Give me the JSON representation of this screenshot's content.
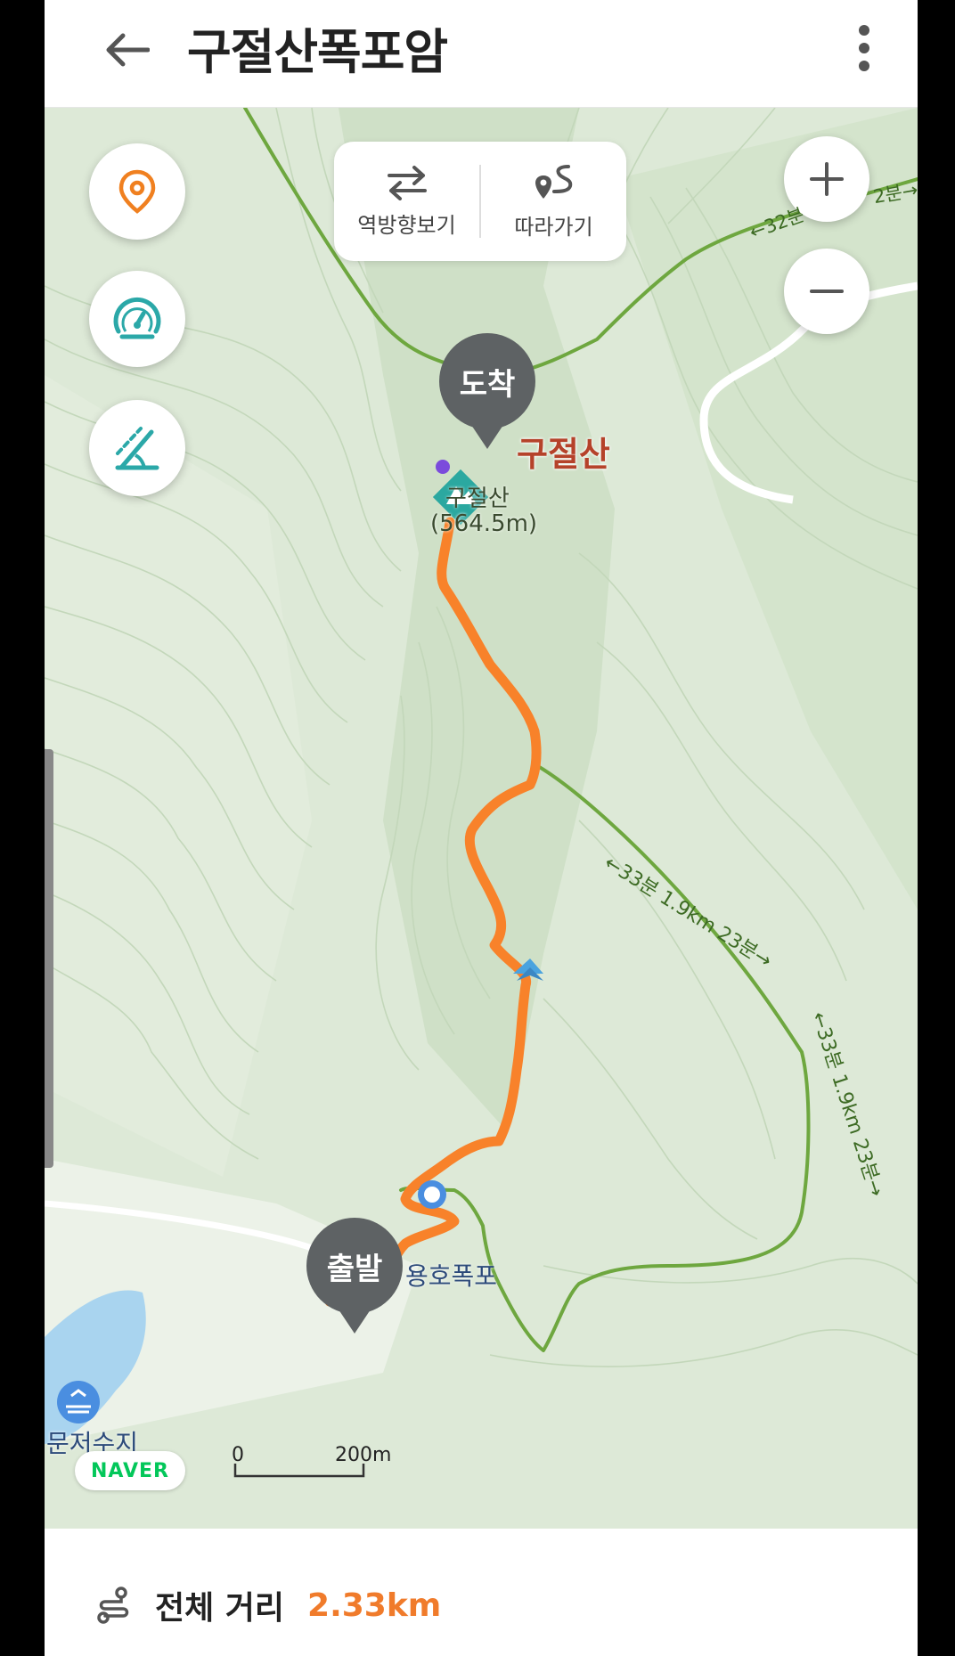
{
  "header": {
    "title": "구절산폭포암"
  },
  "route_tools": {
    "reverse_label": "역방향보기",
    "follow_label": "따라가기"
  },
  "map": {
    "pins": {
      "arrival": "도착",
      "departure": "출발"
    },
    "peak_name_big": "구절산",
    "peak_name": "구절산",
    "peak_elevation": "(564.5m)",
    "waterfall": "용호폭포",
    "reservoir": "문저수지",
    "trail_labels": {
      "top": "←32분",
      "top_right": "2분→",
      "middle": "←33분 1.9km 23분→",
      "right": "←33분 1.9km 23분→"
    },
    "scale": {
      "start": "0",
      "end": "200m"
    },
    "logo": "NAVER"
  },
  "summary": {
    "distance_label": "전체 거리",
    "distance_value": "2.33km"
  },
  "colors": {
    "route": "#f8822a",
    "trail": "#6ea73f",
    "accent": "#f07b2b",
    "peak": "#2ba8a0",
    "pin": "#5e6264"
  }
}
